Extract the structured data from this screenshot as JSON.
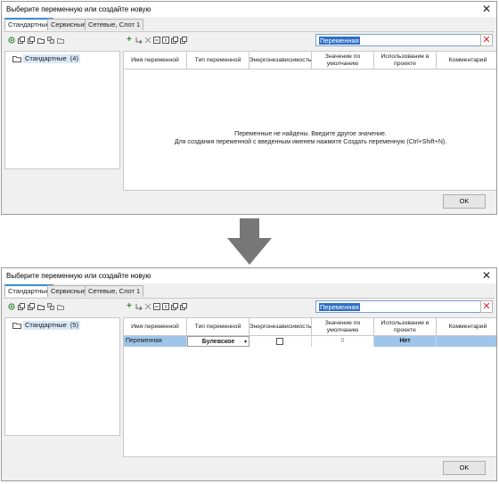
{
  "colors": {
    "accent": "#3c8fd6",
    "selection": "#9fc6ea",
    "danger": "#d9232e",
    "arrow": "#777777"
  },
  "dialogs": [
    {
      "title": "Выберите переменную или создайте новую",
      "tabs": [
        "Стандартные",
        "Сервисные",
        "Сетевые, Слот 1"
      ],
      "search_value": "Переменная",
      "tree": {
        "label": "Стандартные",
        "count": "(4)"
      },
      "columns": [
        "Имя переменной",
        "Тип переменной",
        "Энергонезависимость",
        "Значение по умолчанию",
        "Использование в проекте",
        "Комментарий"
      ],
      "empty_message": [
        "Переменные не найдены. Введите другое значение.",
        "Для создания переменной с введенным именем нажмите Создать переменную (Ctrl+Shift+N)."
      ],
      "ok_label": "OK"
    },
    {
      "title": "Выберите переменную или создайте новую",
      "tabs": [
        "Стандартные",
        "Сервисные",
        "Сетевые, Слот 1"
      ],
      "search_value": "Переменная",
      "tree": {
        "label": "Стандартные",
        "count": "(5)"
      },
      "columns": [
        "Имя переменной",
        "Тип переменной",
        "Энергонезависимость",
        "Значение по умолчанию",
        "Использование в проекте",
        "Комментарий"
      ],
      "row": {
        "name": "Переменная",
        "type": "Булевское",
        "nonvolatile": false,
        "default": "0",
        "usage": "Нет",
        "comment": ""
      },
      "ok_label": "OK"
    }
  ]
}
